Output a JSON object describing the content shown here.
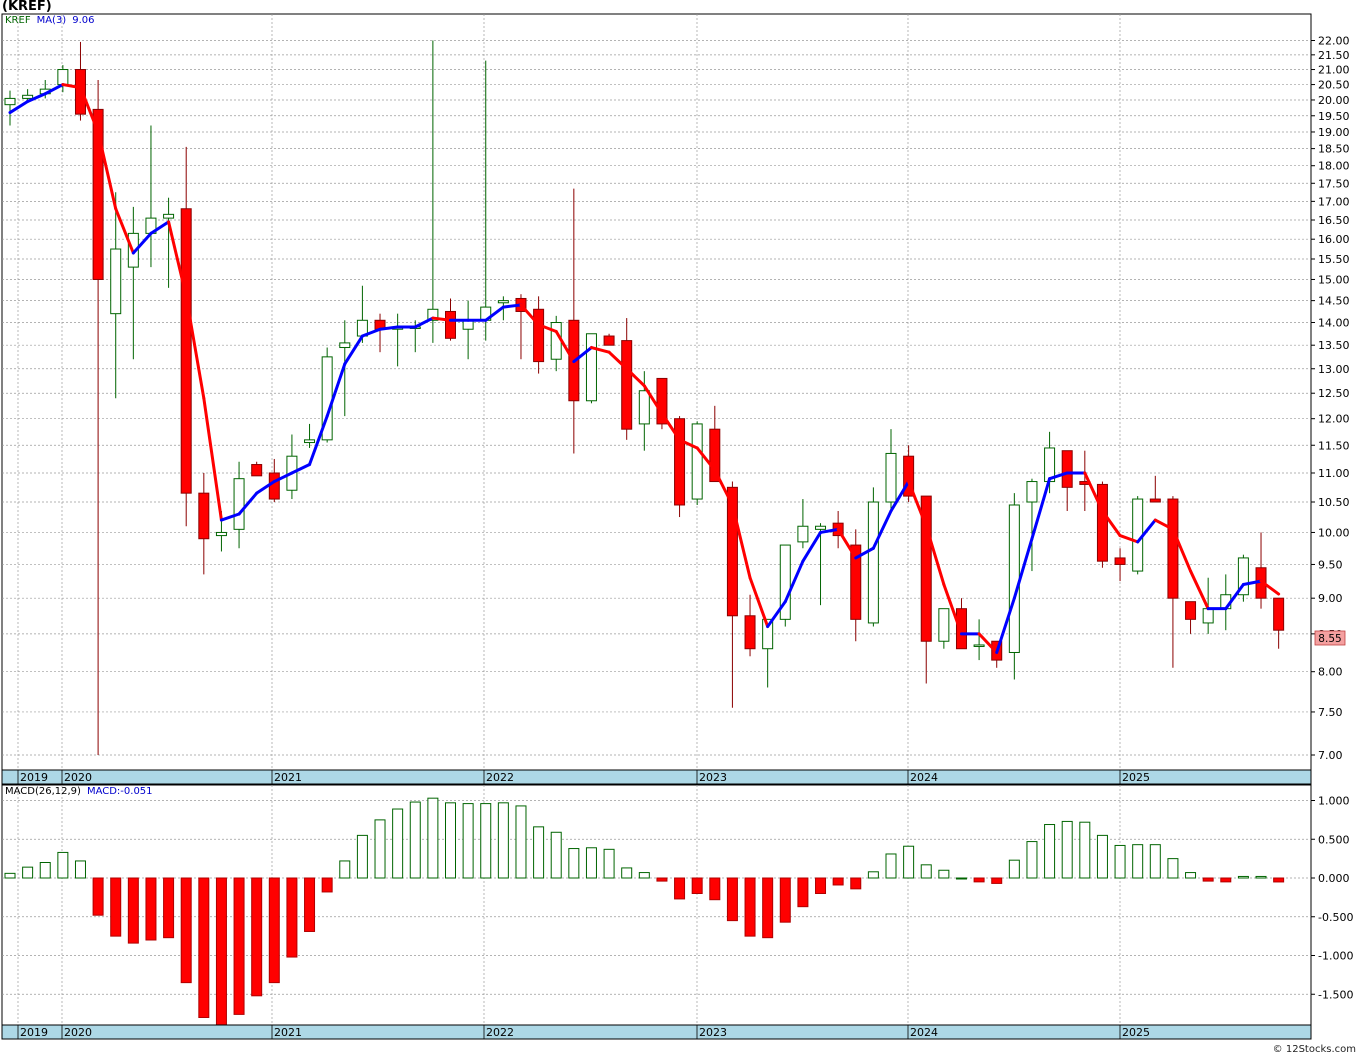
{
  "chart_title": "(KREF)",
  "price_legend": {
    "symbol": "KREF",
    "ma_label": "MA(3)",
    "ma_value": "9.06"
  },
  "macd_legend": {
    "label": "MACD(26,12,9)",
    "value_label": "MACD:-0.051"
  },
  "last_price_label": "8.55",
  "watermark": "© 12Stocks.com",
  "colors": {
    "up_candle_fill": "#ffffff",
    "up_candle_stroke": "#006400",
    "down_candle_fill": "#ff0000",
    "down_candle_stroke": "#8b0000",
    "ma_up": "#0000ff",
    "ma_down": "#ff0000",
    "macd_pos": "#006400",
    "macd_neg": "#ff0000",
    "axis_band": "#add8e6",
    "price_tag": "#f4a0a0"
  },
  "chart_data": [
    {
      "type": "candlestick",
      "panel": "price",
      "interval": "monthly",
      "ylim": [
        6.8,
        22.4
      ],
      "yticks": [
        "22.00",
        "21.50",
        "21.00",
        "20.50",
        "20.00",
        "19.50",
        "19.00",
        "18.50",
        "18.00",
        "17.50",
        "17.00",
        "16.50",
        "16.00",
        "15.50",
        "15.00",
        "14.50",
        "14.00",
        "13.50",
        "13.00",
        "12.50",
        "12.00",
        "11.50",
        "11.00",
        "10.50",
        "10.00",
        "9.50",
        "9.00",
        "8.50",
        "8.00",
        "7.50",
        "7.00"
      ],
      "x_labels": [
        "2019",
        "2020",
        "2021",
        "2022",
        "2023",
        "2024",
        "2025"
      ],
      "grid": true,
      "candles": [
        {
          "o": 19.85,
          "h": 20.3,
          "l": 19.2,
          "c": 20.05
        },
        {
          "o": 20.05,
          "h": 20.35,
          "l": 19.95,
          "c": 20.15
        },
        {
          "o": 20.2,
          "h": 20.65,
          "l": 20.05,
          "c": 20.35
        },
        {
          "o": 20.5,
          "h": 21.15,
          "l": 20.25,
          "c": 21.0
        },
        {
          "o": 21.0,
          "h": 21.95,
          "l": 19.35,
          "c": 19.55
        },
        {
          "o": 19.7,
          "h": 20.65,
          "l": 7.0,
          "c": 15.0
        },
        {
          "o": 14.2,
          "h": 17.25,
          "l": 12.4,
          "c": 15.75
        },
        {
          "o": 15.3,
          "h": 16.85,
          "l": 13.2,
          "c": 16.15
        },
        {
          "o": 16.15,
          "h": 19.2,
          "l": 15.3,
          "c": 16.55
        },
        {
          "o": 16.55,
          "h": 17.1,
          "l": 14.8,
          "c": 16.65
        },
        {
          "o": 16.8,
          "h": 18.55,
          "l": 10.1,
          "c": 10.65
        },
        {
          "o": 10.65,
          "h": 11.0,
          "l": 9.35,
          "c": 9.9
        },
        {
          "o": 9.95,
          "h": 10.35,
          "l": 9.7,
          "c": 10.0
        },
        {
          "o": 10.05,
          "h": 11.2,
          "l": 9.75,
          "c": 10.9
        },
        {
          "o": 11.15,
          "h": 11.2,
          "l": 10.95,
          "c": 10.95
        },
        {
          "o": 11.0,
          "h": 11.25,
          "l": 10.5,
          "c": 10.55
        },
        {
          "o": 10.7,
          "h": 11.7,
          "l": 10.55,
          "c": 11.3
        },
        {
          "o": 11.55,
          "h": 11.9,
          "l": 11.45,
          "c": 11.6
        },
        {
          "o": 11.6,
          "h": 13.45,
          "l": 11.55,
          "c": 13.25
        },
        {
          "o": 13.45,
          "h": 14.05,
          "l": 12.05,
          "c": 13.55
        },
        {
          "o": 13.7,
          "h": 14.85,
          "l": 13.55,
          "c": 14.05
        },
        {
          "o": 14.05,
          "h": 14.2,
          "l": 13.35,
          "c": 13.85
        },
        {
          "o": 13.85,
          "h": 14.2,
          "l": 13.05,
          "c": 13.9
        },
        {
          "o": 13.9,
          "h": 14.05,
          "l": 13.35,
          "c": 13.9
        },
        {
          "o": 14.05,
          "h": 22.0,
          "l": 13.55,
          "c": 14.3
        },
        {
          "o": 14.25,
          "h": 14.55,
          "l": 13.6,
          "c": 13.65
        },
        {
          "o": 13.85,
          "h": 14.5,
          "l": 13.2,
          "c": 14.05
        },
        {
          "o": 14.05,
          "h": 21.3,
          "l": 13.6,
          "c": 14.35
        },
        {
          "o": 14.45,
          "h": 14.6,
          "l": 14.05,
          "c": 14.5
        },
        {
          "o": 14.55,
          "h": 14.65,
          "l": 13.2,
          "c": 14.25
        },
        {
          "o": 14.3,
          "h": 14.6,
          "l": 12.9,
          "c": 13.15
        },
        {
          "o": 13.2,
          "h": 14.15,
          "l": 12.95,
          "c": 14.0
        },
        {
          "o": 14.05,
          "h": 17.35,
          "l": 11.35,
          "c": 12.35
        },
        {
          "o": 12.35,
          "h": 13.75,
          "l": 12.3,
          "c": 13.75
        },
        {
          "o": 13.7,
          "h": 13.75,
          "l": 13.5,
          "c": 13.5
        },
        {
          "o": 13.6,
          "h": 14.1,
          "l": 11.6,
          "c": 11.8
        },
        {
          "o": 11.9,
          "h": 12.95,
          "l": 11.4,
          "c": 12.55
        },
        {
          "o": 12.8,
          "h": 12.8,
          "l": 11.8,
          "c": 11.9
        },
        {
          "o": 12.0,
          "h": 12.05,
          "l": 10.25,
          "c": 10.45
        },
        {
          "o": 10.55,
          "h": 11.95,
          "l": 10.45,
          "c": 11.9
        },
        {
          "o": 11.8,
          "h": 12.25,
          "l": 10.85,
          "c": 10.85
        },
        {
          "o": 10.75,
          "h": 10.85,
          "l": 7.55,
          "c": 8.75
        },
        {
          "o": 8.75,
          "h": 9.05,
          "l": 8.2,
          "c": 8.3
        },
        {
          "o": 8.3,
          "h": 8.7,
          "l": 7.8,
          "c": 8.7
        },
        {
          "o": 8.7,
          "h": 9.75,
          "l": 8.6,
          "c": 9.8
        },
        {
          "o": 9.85,
          "h": 10.55,
          "l": 9.75,
          "c": 10.1
        },
        {
          "o": 10.05,
          "h": 10.15,
          "l": 8.9,
          "c": 10.1
        },
        {
          "o": 10.15,
          "h": 10.35,
          "l": 9.75,
          "c": 9.95
        },
        {
          "o": 9.8,
          "h": 10.05,
          "l": 8.4,
          "c": 8.7
        },
        {
          "o": 8.65,
          "h": 10.75,
          "l": 8.6,
          "c": 10.5
        },
        {
          "o": 10.5,
          "h": 11.8,
          "l": 10.35,
          "c": 11.35
        },
        {
          "o": 11.3,
          "h": 11.5,
          "l": 10.5,
          "c": 10.6
        },
        {
          "o": 10.6,
          "h": 10.6,
          "l": 7.85,
          "c": 8.4
        },
        {
          "o": 8.4,
          "h": 8.85,
          "l": 8.3,
          "c": 8.85
        },
        {
          "o": 8.85,
          "h": 9.0,
          "l": 8.3,
          "c": 8.3
        },
        {
          "o": 8.35,
          "h": 8.7,
          "l": 8.15,
          "c": 8.35
        },
        {
          "o": 8.4,
          "h": 8.4,
          "l": 8.05,
          "c": 8.15
        },
        {
          "o": 8.25,
          "h": 10.65,
          "l": 7.9,
          "c": 10.45
        },
        {
          "o": 10.5,
          "h": 10.9,
          "l": 9.4,
          "c": 10.85
        },
        {
          "o": 10.85,
          "h": 11.75,
          "l": 10.65,
          "c": 11.45
        },
        {
          "o": 11.4,
          "h": 11.4,
          "l": 10.35,
          "c": 10.75
        },
        {
          "o": 10.85,
          "h": 11.4,
          "l": 10.35,
          "c": 10.8
        },
        {
          "o": 10.8,
          "h": 10.85,
          "l": 9.45,
          "c": 9.55
        },
        {
          "o": 9.6,
          "h": 9.75,
          "l": 9.25,
          "c": 9.5
        },
        {
          "o": 9.4,
          "h": 10.6,
          "l": 9.35,
          "c": 10.55
        },
        {
          "o": 10.55,
          "h": 10.95,
          "l": 10.5,
          "c": 10.5
        },
        {
          "o": 10.55,
          "h": 10.6,
          "l": 8.05,
          "c": 9.0
        },
        {
          "o": 8.95,
          "h": 8.95,
          "l": 8.5,
          "c": 8.7
        },
        {
          "o": 8.65,
          "h": 9.3,
          "l": 8.5,
          "c": 8.85
        },
        {
          "o": 8.85,
          "h": 9.35,
          "l": 8.55,
          "c": 9.05
        },
        {
          "o": 9.05,
          "h": 9.65,
          "l": 8.95,
          "c": 9.6
        },
        {
          "o": 9.45,
          "h": 10.0,
          "l": 8.85,
          "c": 9.0
        },
        {
          "o": 9.0,
          "h": 9.0,
          "l": 8.3,
          "c": 8.55
        }
      ],
      "ma3": [
        19.6,
        19.95,
        20.2,
        20.5,
        20.4,
        19.0,
        16.8,
        15.65,
        16.15,
        16.45,
        14.6,
        12.4,
        10.2,
        10.3,
        10.65,
        10.85,
        11.0,
        11.15,
        12.05,
        13.1,
        13.7,
        13.85,
        13.9,
        13.9,
        14.1,
        14.05,
        14.05,
        14.05,
        14.35,
        14.4,
        13.95,
        13.8,
        13.15,
        13.45,
        13.35,
        13.0,
        12.65,
        12.1,
        11.6,
        11.45,
        11.05,
        10.45,
        9.3,
        8.6,
        8.95,
        9.55,
        10.0,
        10.05,
        9.6,
        9.75,
        10.35,
        10.85,
        10.1,
        9.2,
        8.5,
        8.5,
        8.25,
        9.0,
        9.9,
        10.9,
        11.0,
        11.0,
        10.35,
        9.95,
        9.85,
        10.2,
        10.05,
        9.4,
        8.85,
        8.85,
        9.2,
        9.25,
        9.06
      ]
    },
    {
      "type": "bar",
      "panel": "macd",
      "ylim": [
        -1.9,
        1.05
      ],
      "yticks": [
        "1.000",
        "0.500",
        "0.000",
        "-0.500",
        "-1.000",
        "-1.500"
      ],
      "x_labels": [
        "2019",
        "2020",
        "2021",
        "2022",
        "2023",
        "2024",
        "2025"
      ],
      "series": [
        {
          "values": [
            0.06,
            0.14,
            0.2,
            0.33,
            0.22,
            -0.48,
            -0.75,
            -0.84,
            -0.8,
            -0.77,
            -1.35,
            -1.8,
            -1.9,
            -1.76,
            -1.52,
            -1.35,
            -1.02,
            -0.69,
            -0.18,
            0.22,
            0.55,
            0.75,
            0.89,
            0.98,
            1.03,
            0.97,
            0.96,
            0.96,
            0.97,
            0.93,
            0.66,
            0.59,
            0.38,
            0.39,
            0.37,
            0.13,
            0.07,
            -0.04,
            -0.27,
            -0.2,
            -0.28,
            -0.55,
            -0.75,
            -0.77,
            -0.57,
            -0.37,
            -0.2,
            -0.09,
            -0.14,
            0.08,
            0.31,
            0.41,
            0.17,
            0.1,
            0.0,
            -0.05,
            -0.07,
            0.23,
            0.47,
            0.69,
            0.73,
            0.72,
            0.55,
            0.42,
            0.43,
            0.43,
            0.25,
            0.07,
            -0.04,
            -0.05,
            0.02,
            0.02,
            -0.051
          ]
        }
      ]
    }
  ]
}
